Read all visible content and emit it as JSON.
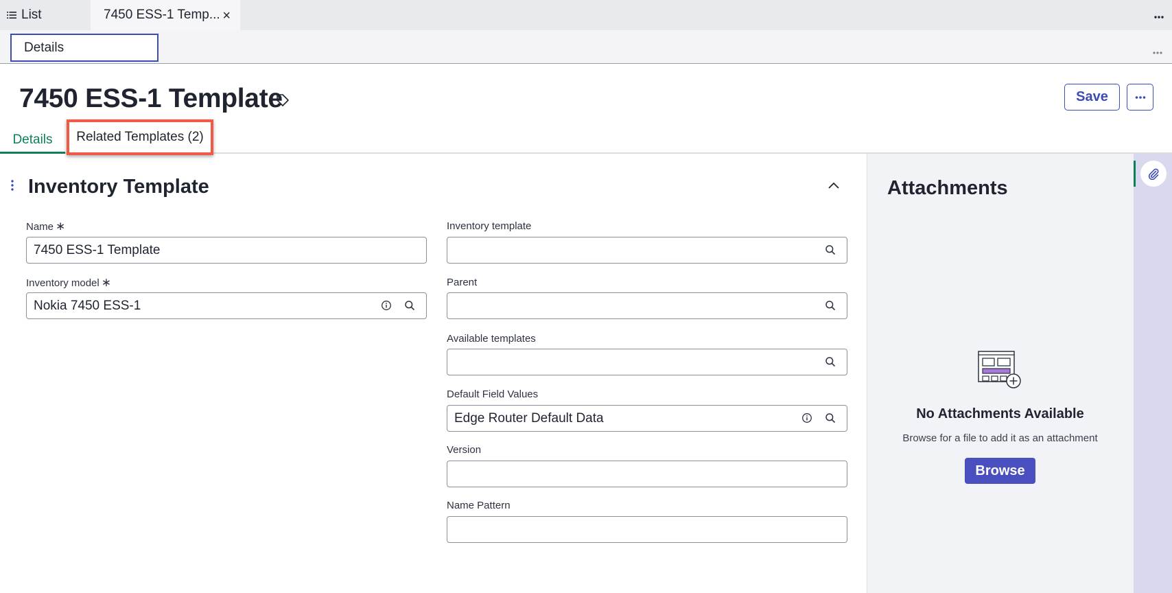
{
  "top_tabs": {
    "list_label": "List",
    "record_tab_label": "7450 ESS-1 Temp...",
    "close_glyph": "×"
  },
  "subbar": {
    "tab_label": "Details"
  },
  "header": {
    "title": "7450 ESS-1 Template",
    "save_label": "Save"
  },
  "form_tabs": {
    "details": "Details",
    "related": "Related Templates (2)"
  },
  "section": {
    "title": "Inventory Template"
  },
  "fields": {
    "name": {
      "label": "Name",
      "required_mark": "∗",
      "value": "7450 ESS-1 Template"
    },
    "inventory_model": {
      "label": "Inventory model",
      "required_mark": "∗",
      "value": "Nokia 7450 ESS-1"
    },
    "inventory_template": {
      "label": "Inventory template",
      "value": ""
    },
    "parent": {
      "label": "Parent",
      "value": ""
    },
    "available_templates": {
      "label": "Available templates",
      "value": ""
    },
    "default_field_values": {
      "label": "Default Field Values",
      "value": "Edge Router Default Data"
    },
    "version": {
      "label": "Version",
      "value": ""
    },
    "name_pattern": {
      "label": "Name Pattern",
      "value": ""
    }
  },
  "attachments": {
    "title": "Attachments",
    "empty_title": "No Attachments Available",
    "empty_hint": "Browse for a file to add it as an attachment",
    "browse_label": "Browse"
  },
  "colors": {
    "accent": "#3c4bb7",
    "active_tab": "#0f7f57",
    "highlight_box": "#f05a46",
    "browse_bg": "#4a4fc0"
  },
  "icons": [
    "list-icon",
    "close-icon",
    "more-horizontal-icon",
    "tag-icon",
    "drag-dots-icon",
    "chevron-up-icon",
    "info-icon",
    "search-icon",
    "attachment-illustration-icon",
    "paperclip-icon"
  ]
}
